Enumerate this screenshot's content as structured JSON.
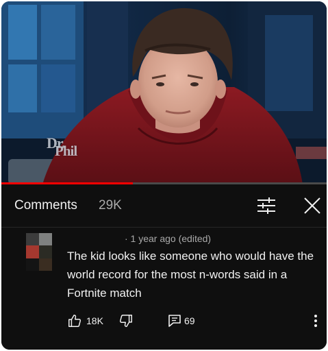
{
  "video": {
    "watermark_line1": "Dr.",
    "watermark_line2": "Phil",
    "progress_fraction": 0.405,
    "buffer_fraction": 0.405
  },
  "comments_header": {
    "title": "Comments",
    "count": "29K"
  },
  "comment": {
    "meta": "· 1 year ago (edited)",
    "text": "The kid looks like someone who would have the world record for the most n-words said in a Fortnite match",
    "likes": "18K",
    "replies": "69"
  },
  "colors": {
    "background": "#0f0f0f",
    "text_primary": "#f1f1f1",
    "text_secondary": "#aaaaaa",
    "progress": "#ff0000"
  },
  "icons": [
    "filter-icon",
    "close-icon",
    "like-icon",
    "dislike-icon",
    "reply-icon",
    "more-vertical-icon"
  ]
}
